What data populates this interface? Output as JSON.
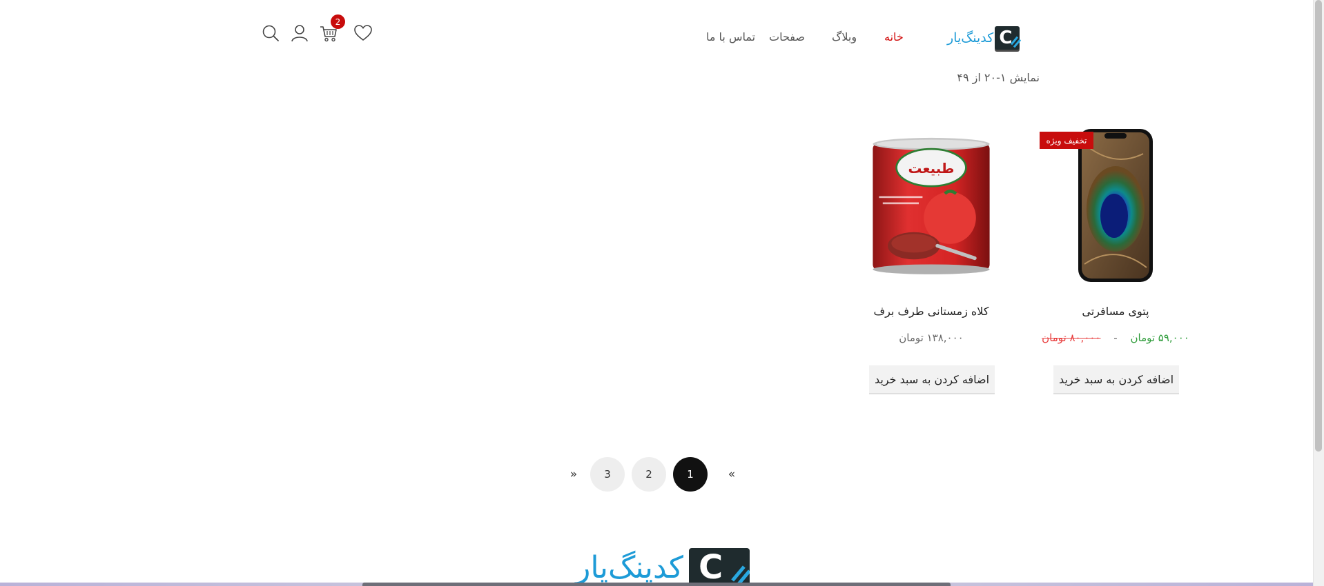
{
  "header": {
    "logo_text": "کدینگ‌یار",
    "logo_mark": "C",
    "nav": [
      {
        "label": "خانه",
        "active": true
      },
      {
        "label": "وبلاگ",
        "active": false
      },
      {
        "label": "صفحات",
        "active": false
      },
      {
        "label": "تماس با ما",
        "active": false
      }
    ],
    "cart_count": "2",
    "icons": [
      "wishlist-heart-icon",
      "cart-icon",
      "user-icon",
      "search-icon"
    ]
  },
  "result_count": "نمایش ۱-۲۰ از ۴۹",
  "products": [
    {
      "title": "پتوی مسافرتی",
      "badge": "تخفیف ویژه",
      "price_sale": "۵۹,۰۰۰ تومان",
      "price_separator": "-",
      "price_regular": "۸۰,۰۰۰ تومان",
      "button_label": "اضافه کردن به سبد خرید"
    },
    {
      "title": "کلاه زمستانی طرف برف",
      "price": "۱۳۸,۰۰۰ تومان",
      "button_label": "اضافه کردن به سبد خرید",
      "image_text": "طبیعت"
    }
  ],
  "pagination": {
    "prev": "«",
    "pages": [
      "1",
      "2",
      "3"
    ],
    "current": "1",
    "next": "»"
  },
  "footer": {
    "logo_text": "کدینگ‌یار",
    "logo_mark": "C"
  },
  "colors": {
    "accent_red": "#c80c0c",
    "nav_active": "#d10a0a",
    "sale_price": "#2e9c3a",
    "logo_blue": "#1d9bd7"
  }
}
